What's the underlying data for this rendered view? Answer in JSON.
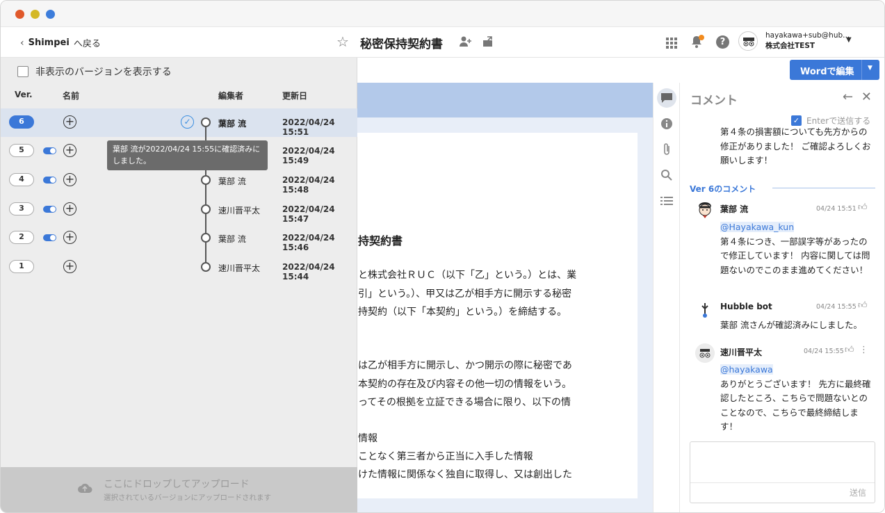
{
  "header": {
    "back_user": "Shimpei",
    "back_label": "へ戻る",
    "doc_title": "秘密保持契約書",
    "user_email": "hayakawa+sub@hub...",
    "user_company": "株式会社TEST"
  },
  "versions": {
    "show_hidden_label": "非表示のバージョンを表示する",
    "columns": {
      "ver": "Ver.",
      "name": "名前",
      "editor": "編集者",
      "updated": "更新日"
    },
    "rows": [
      {
        "ver": "6",
        "editor": "葉部 流",
        "date": "2022/04/24 15:51"
      },
      {
        "ver": "5",
        "editor": "",
        "date": "2022/04/24 15:49"
      },
      {
        "ver": "4",
        "editor": "葉部 流",
        "date": "2022/04/24 15:48"
      },
      {
        "ver": "3",
        "editor": "速川晋平太",
        "date": "2022/04/24 15:47"
      },
      {
        "ver": "2",
        "editor": "葉部 流",
        "date": "2022/04/24 15:46"
      },
      {
        "ver": "1",
        "editor": "速川晋平太",
        "date": "2022/04/24 15:44"
      }
    ],
    "tooltip": "葉部 流が2022/04/24 15:55に確認済みにしました。",
    "drop_main": "ここにドロップしてアップロード",
    "drop_sub": "選択されているバージョンにアップロードされます"
  },
  "toolbar": {
    "word_button": "Wordで編集"
  },
  "document": {
    "heading": "持契約書",
    "lines": [
      "と株式会社ＲＵＣ（以下「乙」という。）とは、業",
      "引」という。）、甲又は乙が相手方に開示する秘密",
      "持契約（以下「本契約」という。）を締結する。",
      "は乙が相手方に開示し、かつ開示の際に秘密であ",
      "本契約の存在及び内容その他一切の情報をいう。",
      "ってその根拠を立証できる場合に限り、以下の情",
      "情報",
      "ことなく第三者から正当に入手した情報",
      "けた情報に関係なく独自に取得し、又は創出した"
    ]
  },
  "comments": {
    "title": "コメント",
    "enter_send": "Enterで送信する",
    "prev_comment": "第４条の損害額についても先方からの修正がありました！ ご確認よろしくお願いします！",
    "section_label": "Ver 6のコメント",
    "items": [
      {
        "author": "葉部 流",
        "time": "04/24 15:51",
        "mention": "@Hayakawa_kun",
        "text": "第４条につき、一部誤字等があったので修正しています！ 内容に関しては問題ないのでこのまま進めてください！"
      },
      {
        "author": "Hubble bot",
        "time": "04/24 15:55",
        "mention": "",
        "text": "葉部 流さんが確認済みにしました。"
      },
      {
        "author": "速川晋平太",
        "time": "04/24 15:55",
        "mention": "@hayakawa",
        "text": "ありがとうございます！ 先方に最終確認したところ、こちらで問題ないとのことなので、こちらで最終締結します！"
      }
    ],
    "send_label": "送信"
  },
  "colors": {
    "accent": "#3b78d8",
    "active_row": "#dbe3ef",
    "panel": "#ededed"
  }
}
